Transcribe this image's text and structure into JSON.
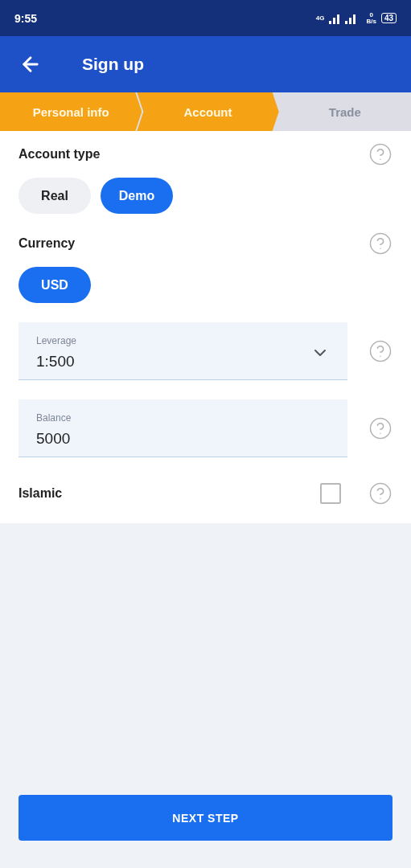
{
  "status_bar": {
    "time": "9:55",
    "network": "4G",
    "speed_value": "0",
    "speed_unit": "B/s",
    "battery": "43"
  },
  "header": {
    "title": "Sign up"
  },
  "steps": [
    {
      "label": "Personal info",
      "active": true
    },
    {
      "label": "Account",
      "active": true
    },
    {
      "label": "Trade",
      "active": false
    }
  ],
  "account_type": {
    "label": "Account type",
    "options": [
      {
        "label": "Real",
        "selected": false
      },
      {
        "label": "Demo",
        "selected": true
      }
    ]
  },
  "currency": {
    "label": "Currency",
    "options": [
      {
        "label": "USD",
        "selected": true
      }
    ]
  },
  "leverage": {
    "label": "Leverage",
    "value": "1:500"
  },
  "balance": {
    "label": "Balance",
    "value": "5000"
  },
  "islamic": {
    "label": "Islamic",
    "checked": false
  },
  "next_button": {
    "label": "NEXT STEP"
  }
}
